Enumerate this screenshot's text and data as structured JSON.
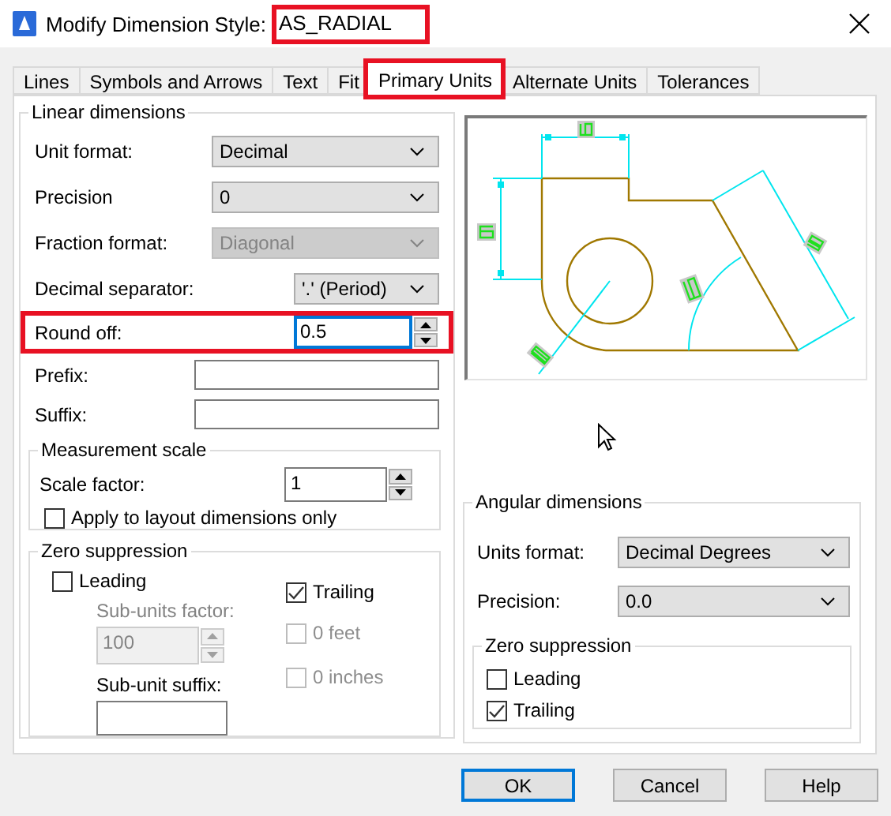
{
  "window": {
    "title": "Modify Dimension Style:",
    "style_name": "AS_RADIAL",
    "style_name_highlighted": true
  },
  "tabs": [
    {
      "label": "Lines",
      "selected": false,
      "highlighted": false
    },
    {
      "label": "Symbols and Arrows",
      "selected": false,
      "highlighted": false
    },
    {
      "label": "Text",
      "selected": false,
      "highlighted": false
    },
    {
      "label": "Fit",
      "selected": false,
      "highlighted": false
    },
    {
      "label": "Primary Units",
      "selected": true,
      "highlighted": true
    },
    {
      "label": "Alternate Units",
      "selected": false,
      "highlighted": false
    },
    {
      "label": "Tolerances",
      "selected": false,
      "highlighted": false
    }
  ],
  "linear_dimensions": {
    "title": "Linear dimensions",
    "fields": [
      {
        "kind": "combo",
        "label": "Unit format:",
        "value": "Decimal",
        "disabled": false,
        "focused": false,
        "highlighted": false
      },
      {
        "kind": "combo",
        "label": "Precision",
        "value": "0",
        "disabled": false,
        "focused": false,
        "highlighted": false
      },
      {
        "kind": "combo",
        "label": "Fraction format:",
        "value": "Diagonal",
        "disabled": true,
        "focused": false,
        "highlighted": false
      },
      {
        "kind": "combo",
        "label": "Decimal separator:",
        "value": "'.' (Period)",
        "disabled": false,
        "focused": false,
        "highlighted": false
      },
      {
        "kind": "spin",
        "label": "Round off:",
        "value": "0.5",
        "disabled": false,
        "focused": true,
        "highlighted": true
      },
      {
        "kind": "text",
        "label": "Prefix:",
        "disabled": false,
        "focused": false,
        "highlighted": false
      },
      {
        "kind": "text",
        "label": "Suffix:",
        "disabled": false,
        "focused": false,
        "highlighted": false
      }
    ],
    "measurement_scale": {
      "title": "Measurement scale",
      "scale_factor": {
        "kind": "spin",
        "label": "Scale factor:",
        "value": "1",
        "disabled": false
      },
      "apply_to_layout": {
        "label": "Apply to layout dimensions only",
        "checked": false,
        "disabled": false
      }
    },
    "zero_suppression": {
      "title": "Zero suppression",
      "leading": {
        "label": "Leading",
        "checked": false,
        "disabled": false
      },
      "trailing": {
        "label": "Trailing",
        "checked": true,
        "disabled": false
      },
      "sub_units_factor": {
        "kind": "spin",
        "label": "Sub-units factor:",
        "value": "100",
        "disabled": true
      },
      "sub_unit_suffix": {
        "kind": "text",
        "label": "Sub-unit suffix:",
        "disabled": false
      },
      "feet": {
        "label": "0 feet",
        "checked": false,
        "disabled": true
      },
      "inches": {
        "label": "0 inches",
        "checked": false,
        "disabled": true
      }
    }
  },
  "angular_dimensions": {
    "title": "Angular dimensions",
    "fields": [
      {
        "kind": "combo",
        "label": "Units format:",
        "value": "Decimal Degrees",
        "disabled": false
      },
      {
        "kind": "combo",
        "label": "Precision:",
        "value": "0.0",
        "disabled": false
      }
    ],
    "zero_suppression": {
      "title": "Zero suppression",
      "options": [
        {
          "label": "Leading",
          "checked": false,
          "disabled": false
        },
        {
          "label": "Trailing",
          "checked": true,
          "disabled": false
        }
      ]
    }
  },
  "buttons": [
    {
      "label": "OK",
      "default": true
    },
    {
      "label": "Cancel",
      "default": false
    },
    {
      "label": "Help",
      "default": false
    }
  ]
}
